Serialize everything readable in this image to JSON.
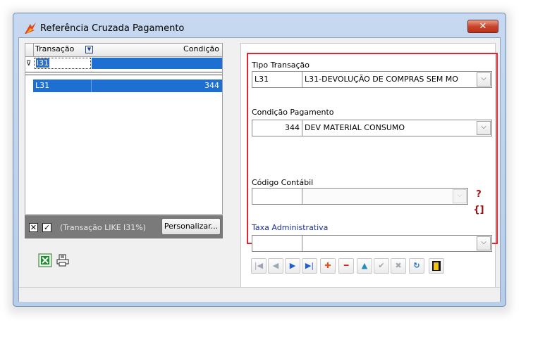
{
  "window": {
    "title": "Referência Cruzada Pagamento",
    "close_label": "✕"
  },
  "grid": {
    "columns": [
      "Transação",
      "Condição"
    ],
    "filter_value": "l31",
    "rows": [
      {
        "transacao": "L31",
        "condicao": "344"
      }
    ]
  },
  "filter_bar": {
    "expression": "(Transação LIKE l31%)",
    "customize_label": "Personalizar..."
  },
  "form": {
    "tipo_transacao": {
      "label": "Tipo Transação",
      "code": "L31",
      "description": "L31-DEVOLUÇÃO DE COMPRAS SEM MO"
    },
    "condicao_pagamento": {
      "label": "Condição Pagamento",
      "code": "344",
      "description": "DEV MATERIAL CONSUMO"
    },
    "codigo_contabil": {
      "label": "Código Contábil",
      "code": "",
      "description": ""
    },
    "taxa_administrativa": {
      "label": "Taxa Administrativa",
      "code": "",
      "description": ""
    }
  },
  "icons": {
    "chevron": "⌵",
    "help": "?{]"
  },
  "colors": {
    "selection": "#1d6fd1",
    "highlight_border": "#e0262f",
    "title_bar": "#c6d9f0"
  }
}
